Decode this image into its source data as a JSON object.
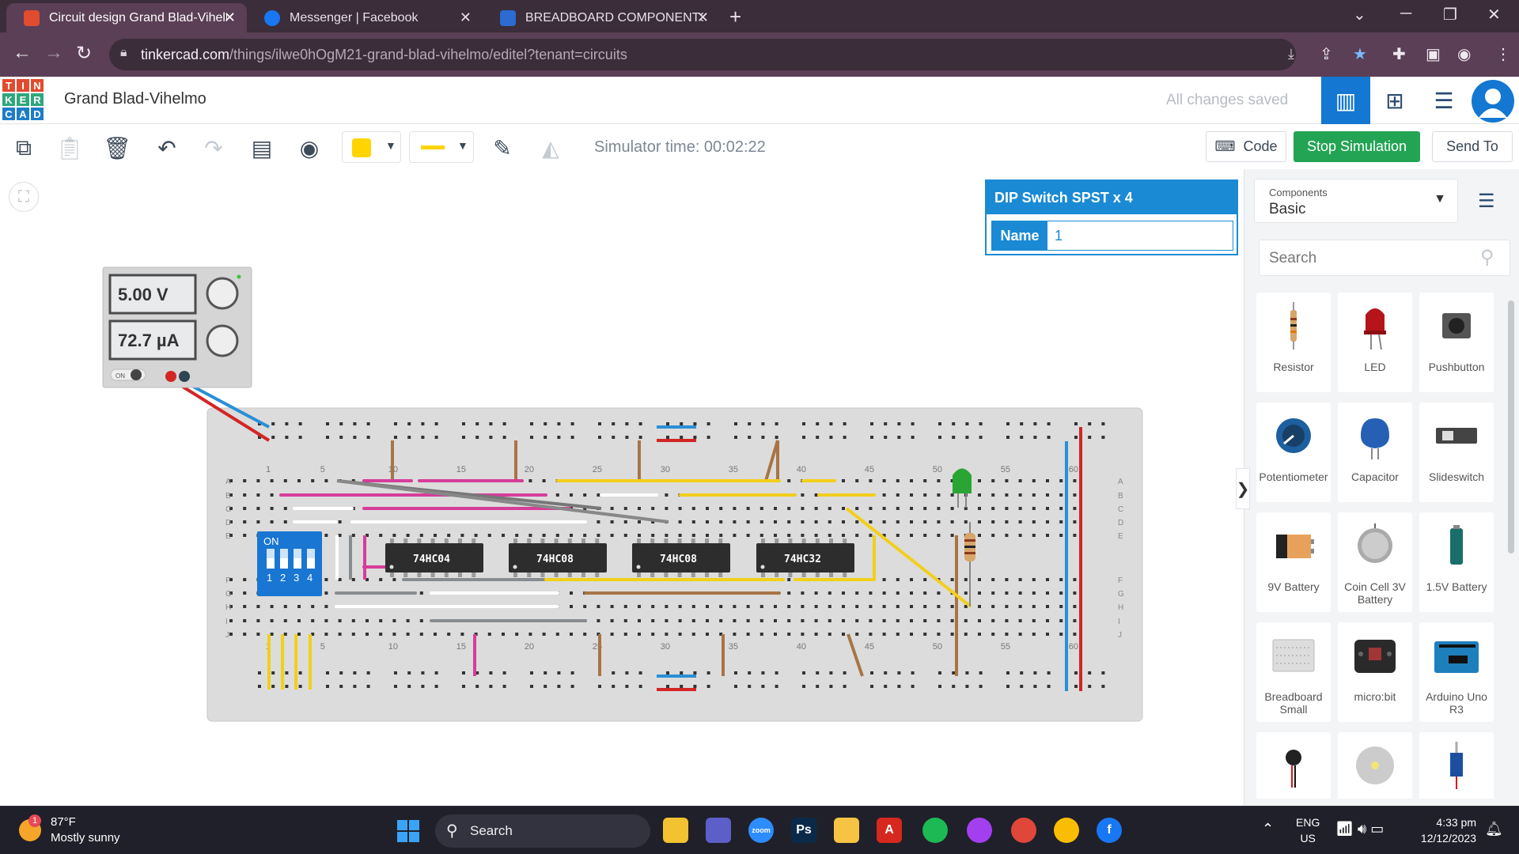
{
  "browser": {
    "tabs": [
      {
        "title": "Circuit design Grand Blad-Vihelmo",
        "active": true,
        "icon": "tinkercad-icon",
        "color": "#e14b2f"
      },
      {
        "title": "Messenger | Facebook",
        "active": false,
        "icon": "facebook-icon",
        "color": "#1877f2"
      },
      {
        "title": "BREADBOARD COMPONENTS &",
        "active": false,
        "icon": "breadboard-site-icon",
        "color": "#2d6ad1"
      }
    ],
    "new_tab": "+",
    "url_host": "tinkercad.com",
    "url_path": "/things/ilwe0hOgM21-grand-blad-vihelmo/editel?tenant=circuits"
  },
  "app": {
    "logo_letters": [
      "T",
      "I",
      "N",
      "K",
      "E",
      "R",
      "C",
      "A",
      "D"
    ],
    "logo_colors": [
      "#e14b2f",
      "#e14b2f",
      "#e14b2f",
      "#2ea77c",
      "#2ea77c",
      "#2ea77c",
      "#1e7dc9",
      "#1e7dc9",
      "#1e7dc9"
    ],
    "design_title": "Grand Blad-Vihelmo",
    "save_status": "All changes saved",
    "view_buttons": [
      "circuit-view-icon",
      "schematic-view-icon",
      "component-list-icon"
    ]
  },
  "toolbar": {
    "fill_color": "#ffd400",
    "wire_color": "#ffd400",
    "simulator_time": "Simulator time: 00:02:22",
    "code_label": "Code",
    "stop_label": "Stop Simulation",
    "send_label": "Send To"
  },
  "power_supply": {
    "voltage": "5.00 V",
    "current": "72.7 µA",
    "on_label": "ON"
  },
  "breadboard": {
    "column_numbers": [
      "1",
      "5",
      "10",
      "15",
      "20",
      "25",
      "30",
      "35",
      "40",
      "45",
      "50",
      "55",
      "60"
    ],
    "row_letters_top": [
      "A",
      "B",
      "C",
      "D",
      "E"
    ],
    "row_letters_bottom": [
      "F",
      "G",
      "H",
      "I",
      "J"
    ],
    "chips": [
      "74HC04",
      "74HC08",
      "74HC08",
      "74HC32"
    ],
    "dip_switch": {
      "on_label": "ON",
      "numbers": [
        "1",
        "2",
        "3",
        "4"
      ]
    }
  },
  "inspector": {
    "title": "DIP Switch SPST x 4",
    "name_label": "Name",
    "name_value": "1"
  },
  "components": {
    "category_caption": "Components",
    "category_value": "Basic",
    "search_placeholder": "Search",
    "items": [
      {
        "label": "Resistor",
        "icon": "resistor-icon"
      },
      {
        "label": "LED",
        "icon": "led-icon"
      },
      {
        "label": "Pushbutton",
        "icon": "pushbutton-icon"
      },
      {
        "label": "Potentiometer",
        "icon": "potentiometer-icon"
      },
      {
        "label": "Capacitor",
        "icon": "capacitor-icon"
      },
      {
        "label": "Slideswitch",
        "icon": "slideswitch-icon"
      },
      {
        "label": "9V Battery",
        "icon": "battery-9v-icon"
      },
      {
        "label": "Coin Cell 3V Battery",
        "icon": "coin-cell-icon"
      },
      {
        "label": "1.5V Battery",
        "icon": "battery-aa-icon"
      },
      {
        "label": "Breadboard Small",
        "icon": "breadboard-icon"
      },
      {
        "label": "micro:bit",
        "icon": "microbit-icon"
      },
      {
        "label": "Arduino Uno R3",
        "icon": "arduino-icon"
      },
      {
        "label": "",
        "icon": "vibration-motor-icon"
      },
      {
        "label": "",
        "icon": "dc-motor-icon"
      },
      {
        "label": "",
        "icon": "servo-icon"
      }
    ]
  },
  "taskbar": {
    "weather_badge": "1",
    "temperature": "87°F",
    "condition": "Mostly sunny",
    "search_label": "Search",
    "lang_line1": "ENG",
    "lang_line2": "US",
    "time": "4:33 pm",
    "date": "12/12/2023",
    "apps": [
      {
        "name": "file-explorer-icon",
        "color": "#f2c230",
        "glyph": ""
      },
      {
        "name": "meet-icon",
        "color": "#5b5fc7",
        "glyph": ""
      },
      {
        "name": "zoom-icon",
        "color": "#2d8cff",
        "glyph": "zoom"
      },
      {
        "name": "photoshop-icon",
        "color": "#0b2a4a",
        "glyph": "Ps"
      },
      {
        "name": "folder-icon",
        "color": "#f6c344",
        "glyph": ""
      },
      {
        "name": "acrobat-icon",
        "color": "#d6281e",
        "glyph": "A"
      },
      {
        "name": "spotify-icon",
        "color": "#1db954",
        "glyph": ""
      },
      {
        "name": "messenger-icon",
        "color": "#a43ff0",
        "glyph": ""
      },
      {
        "name": "chrome-icon",
        "color": "#e0463a",
        "glyph": ""
      },
      {
        "name": "chrome-profile-icon",
        "color": "#fbbc05",
        "glyph": ""
      },
      {
        "name": "facebook-icon",
        "color": "#1877f2",
        "glyph": "f"
      }
    ]
  }
}
